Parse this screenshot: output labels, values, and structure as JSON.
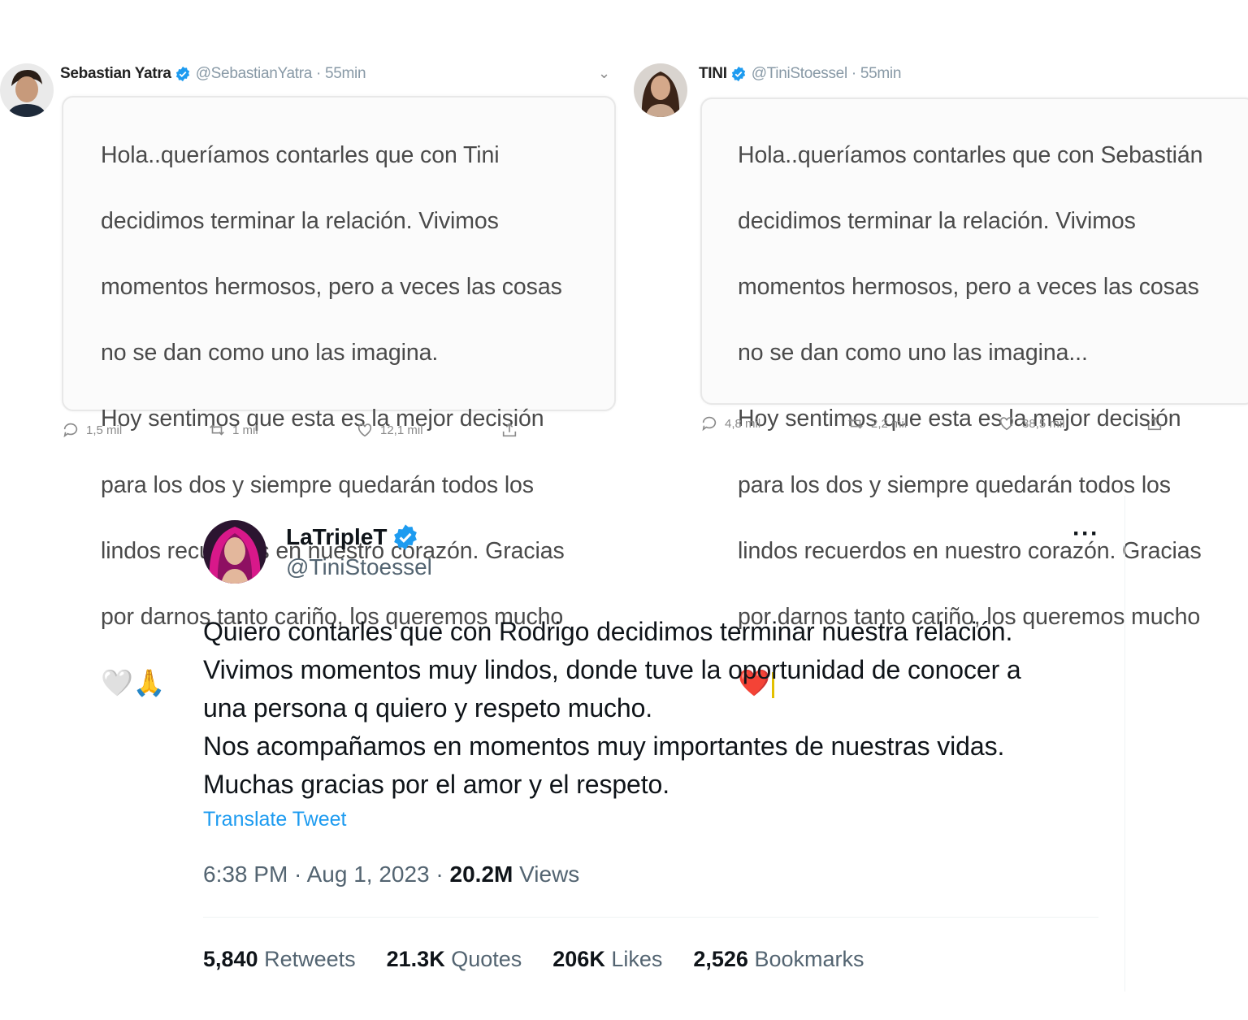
{
  "tweet_yatra": {
    "name": "Sebastian Yatra",
    "meta": "@SebastianYatra · 55min",
    "lines": [
      "Hola..queríamos contarles que con Tini",
      "decidimos terminar la relación. Vivimos",
      "momentos hermosos, pero a veces las cosas",
      "no se dan como uno las imagina.",
      "Hoy sentimos que esta es la mejor decisión",
      "para los dos y siempre quedarán todos los",
      "lindos recuerdos en nuestro corazón. Gracias",
      "por darnos tanto cariño, los queremos mucho"
    ],
    "emoji": "🤍🙏",
    "replies": "1,5 mil",
    "retweets": "1 mil",
    "likes": "12,1 mil"
  },
  "tweet_tini_old": {
    "name": "TINI",
    "meta": "@TiniStoessel · 55min",
    "lines": [
      "Hola..queríamos contarles que con Sebastián",
      "decidimos terminar la relación. Vivimos",
      "momentos hermosos, pero a veces las cosas",
      "no se dan como uno las imagina...",
      "Hoy sentimos que esta es la mejor decisión",
      "para los dos y siempre quedarán todos los",
      "lindos recuerdos en nuestro corazón. Gracias",
      "por darnos tanto cariño, los queremos mucho"
    ],
    "emoji": "❤️",
    "replies": "4,8 mil",
    "retweets": "2,2 mil",
    "likes": "38,5 mil"
  },
  "main_tweet": {
    "name": "LaTripleT",
    "handle": "@TiniStoessel",
    "text": "Quiero contarles que con Rodrigo decidimos terminar nuestra relación.\nVivimos momentos muy lindos, donde tuve la oportunidad de conocer a\nuna persona q quiero y respeto mucho.\nNos acompañamos en momentos muy importantes de nuestras vidas.\nMuchas gracias por el amor y el respeto.",
    "translate_label": "Translate Tweet",
    "timestamp": "6:38 PM · Aug 1, 2023 · ",
    "views_count": "20.2M",
    "views_label": " Views",
    "stats": {
      "retweets_count": "5,840",
      "retweets_label": " Retweets",
      "quotes_count": "21.3K",
      "quotes_label": " Quotes",
      "likes_count": "206K",
      "likes_label": " Likes",
      "bookmarks_count": "2,526",
      "bookmarks_label": " Bookmarks"
    }
  },
  "colors": {
    "verified": "#1d9bf0",
    "link": "#1d9bf0",
    "secondary_text": "#536471"
  },
  "icons": [
    "verified-badge-icon",
    "chevron-down-icon",
    "reply-icon",
    "retweet-icon",
    "like-icon",
    "share-icon",
    "more-options-icon"
  ]
}
